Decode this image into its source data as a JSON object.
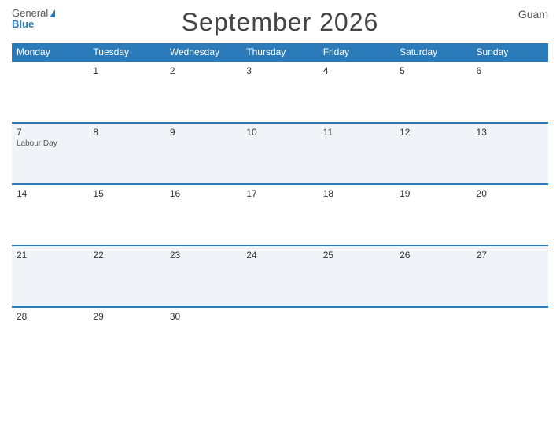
{
  "header": {
    "logo_general": "General",
    "logo_blue": "Blue",
    "title": "September 2026",
    "region": "Guam"
  },
  "days_of_week": [
    "Monday",
    "Tuesday",
    "Wednesday",
    "Thursday",
    "Friday",
    "Saturday",
    "Sunday"
  ],
  "weeks": [
    {
      "style": "alt",
      "days": [
        {
          "num": "",
          "event": ""
        },
        {
          "num": "1",
          "event": ""
        },
        {
          "num": "2",
          "event": ""
        },
        {
          "num": "3",
          "event": ""
        },
        {
          "num": "4",
          "event": ""
        },
        {
          "num": "5",
          "event": ""
        },
        {
          "num": "6",
          "event": ""
        }
      ]
    },
    {
      "style": "main",
      "days": [
        {
          "num": "7",
          "event": "Labour Day"
        },
        {
          "num": "8",
          "event": ""
        },
        {
          "num": "9",
          "event": ""
        },
        {
          "num": "10",
          "event": ""
        },
        {
          "num": "11",
          "event": ""
        },
        {
          "num": "12",
          "event": ""
        },
        {
          "num": "13",
          "event": ""
        }
      ]
    },
    {
      "style": "alt",
      "days": [
        {
          "num": "14",
          "event": ""
        },
        {
          "num": "15",
          "event": ""
        },
        {
          "num": "16",
          "event": ""
        },
        {
          "num": "17",
          "event": ""
        },
        {
          "num": "18",
          "event": ""
        },
        {
          "num": "19",
          "event": ""
        },
        {
          "num": "20",
          "event": ""
        }
      ]
    },
    {
      "style": "main",
      "days": [
        {
          "num": "21",
          "event": ""
        },
        {
          "num": "22",
          "event": ""
        },
        {
          "num": "23",
          "event": ""
        },
        {
          "num": "24",
          "event": ""
        },
        {
          "num": "25",
          "event": ""
        },
        {
          "num": "26",
          "event": ""
        },
        {
          "num": "27",
          "event": ""
        }
      ]
    },
    {
      "style": "alt",
      "days": [
        {
          "num": "28",
          "event": ""
        },
        {
          "num": "29",
          "event": ""
        },
        {
          "num": "30",
          "event": ""
        },
        {
          "num": "",
          "event": ""
        },
        {
          "num": "",
          "event": ""
        },
        {
          "num": "",
          "event": ""
        },
        {
          "num": "",
          "event": ""
        }
      ]
    }
  ]
}
